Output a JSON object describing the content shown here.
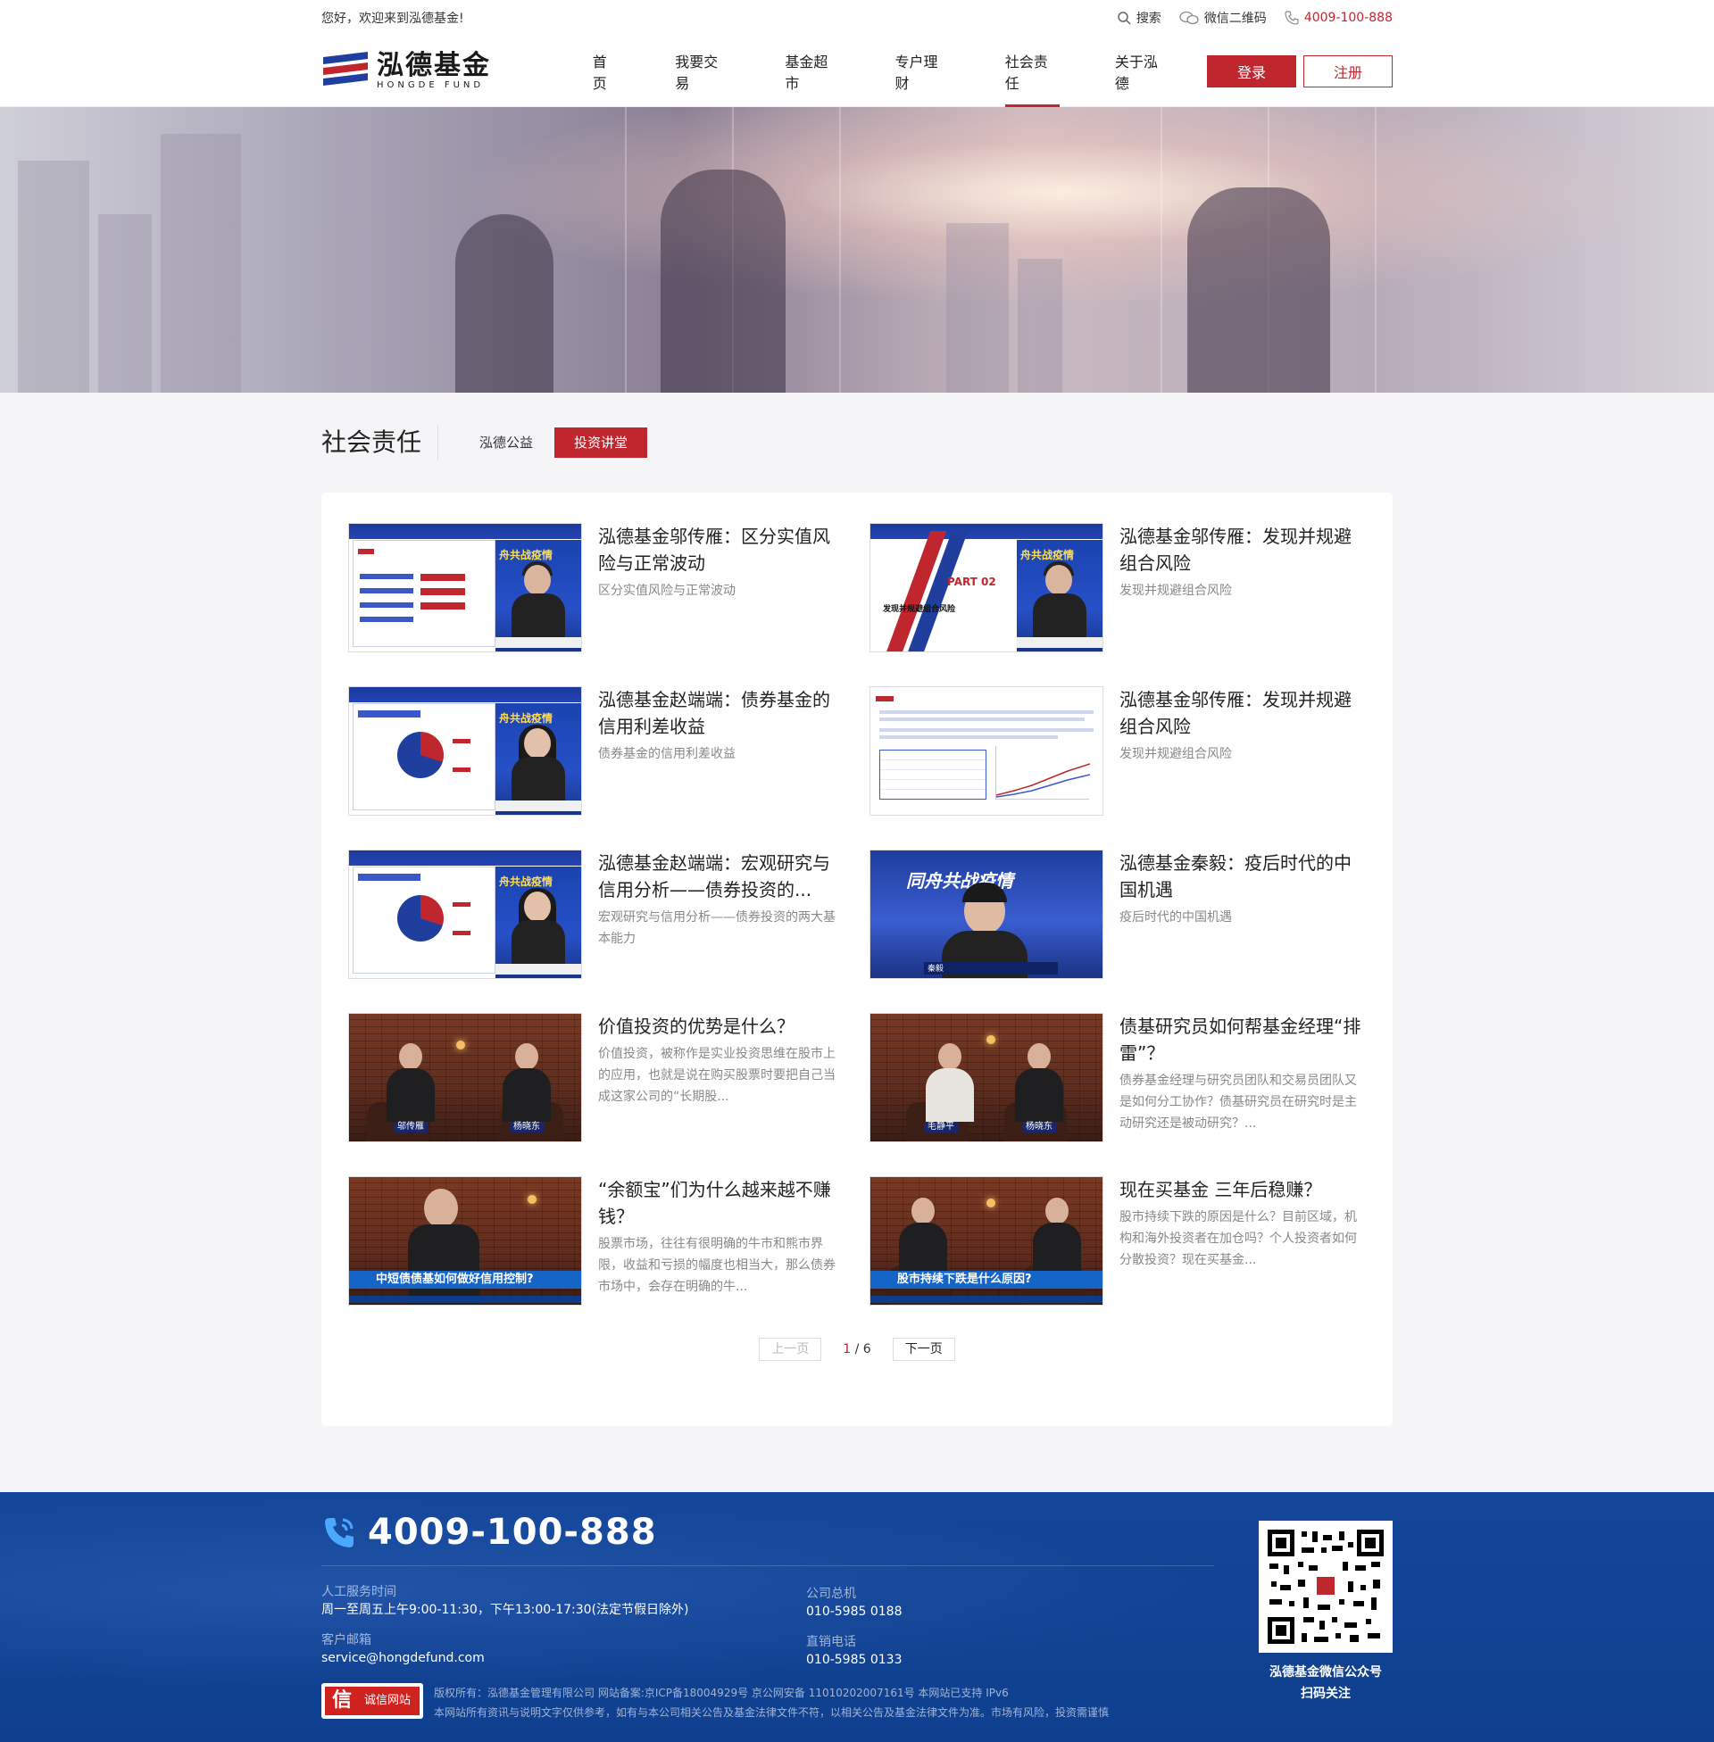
{
  "topbar": {
    "welcome": "您好，欢迎来到泓德基金!",
    "search": "搜索",
    "wechat_qr": "微信二维码",
    "hotline": "4009-100-888"
  },
  "header": {
    "logo_cn": "泓德基金",
    "logo_en": "HONGDE FUND",
    "nav": [
      "首页",
      "我要交易",
      "基金超市",
      "专户理财",
      "社会责任",
      "关于泓德"
    ],
    "active_nav": "社会责任",
    "login": "登录",
    "register": "注册"
  },
  "section": {
    "title": "社会责任",
    "tabs": [
      "泓德公益",
      "投资讲堂"
    ],
    "active_tab": "投资讲堂"
  },
  "items": [
    {
      "title": "泓德基金邬传雁：区分实值风险与正常波动",
      "desc": "区分实值风险与正常波动",
      "thumb": "slide-list"
    },
    {
      "title": "泓德基金邬传雁：发现并规避组合风险",
      "desc": "发现并规避组合风险",
      "thumb": "slide-part"
    },
    {
      "title": "泓德基金赵端端：债券基金的信用利差收益",
      "desc": "债券基金的信用利差收益",
      "thumb": "slide-pie"
    },
    {
      "title": "泓德基金邬传雁：发现并规避组合风险",
      "desc": "发现并规避组合风险",
      "thumb": "slide-table"
    },
    {
      "title": "泓德基金赵端端：宏观研究与信用分析——债券投资的...",
      "desc": "宏观研究与信用分析——债券投资的两大基本能力",
      "thumb": "slide-pie"
    },
    {
      "title": "泓德基金秦毅：疫后时代的中国机遇",
      "desc": "疫后时代的中国机遇",
      "thumb": "studio"
    },
    {
      "title": "价值投资的优势是什么？",
      "desc": "价值投资，被称作是实业投资思维在股市上的应用，也就是说在购买股票时要把自己当成这家公司的“长期股...",
      "thumb": "brick-two"
    },
    {
      "title": "债基研究员如何帮基金经理“排雷”？",
      "desc": "债券基金经理与研究员团队和交易员团队又是如何分工协作？债基研究员在研究时是主动研究还是被动研究？...",
      "thumb": "brick-two"
    },
    {
      "title": "“余额宝”们为什么越来越不赚钱？",
      "desc": "股票市场，往往有很明确的牛市和熊市界限，收益和亏损的幅度也相当大，那么债券市场中，会存在明确的牛...",
      "thumb": "brick-one"
    },
    {
      "title": "现在买基金 三年后稳赚？",
      "desc": "股市持续下跌的原因是什么？目前区域，机构和海外投资者在加仓吗？个人投资者如何分散投资？现在买基金...",
      "thumb": "brick-two-strip"
    }
  ],
  "thumb_text": {
    "studio_big": "同舟共战疫情",
    "studio_name": "秦毅",
    "part": "PART 02",
    "part_sub": "发现并规避组合风险",
    "host_yellow": "舟共战疫情",
    "brick_names_a": [
      "邬传雁",
      "杨晓东"
    ],
    "brick_names_b": [
      "毛静平",
      "杨晓东"
    ],
    "strip_c": "中短债债基如何做好信用控制?",
    "strip_d": "股市持续下跌是什么原因?"
  },
  "pager": {
    "prev": "上一页",
    "current": "1",
    "total": "/ 6",
    "next": "下一页"
  },
  "footer": {
    "phone": "4009-100-888",
    "service_label": "人工服务时间",
    "service_value": "周一至周五上午9:00-11:30，下午13:00-17:30(法定节假日除外)",
    "email_label": "客户邮箱",
    "email_value": "service@hongdefund.com",
    "hq_label": "公司总机",
    "hq_value": "010-5985 0188",
    "direct_label": "直销电话",
    "direct_value": "010-5985 0133",
    "qr_caption_1": "泓德基金微信公众号",
    "qr_caption_2": "扫码关注",
    "badge": "诚信网站",
    "badge_icon": "信",
    "copyright": "版权所有：泓德基金管理有限公司   网站备案:京ICP备18004929号   京公网安备 11010202007161号 本网站已支持 IPv6",
    "disclaimer": "本网站所有资讯与说明文字仅供参考，如有与本公司相关公告及基金法律文件不符，以相关公告及基金法律文件为准。市场有风险，投资需谨慎"
  },
  "colors": {
    "brand_red": "#c0262d",
    "footer_blue": "#0f3f8e",
    "logo_blue": "#1f3e9e"
  }
}
